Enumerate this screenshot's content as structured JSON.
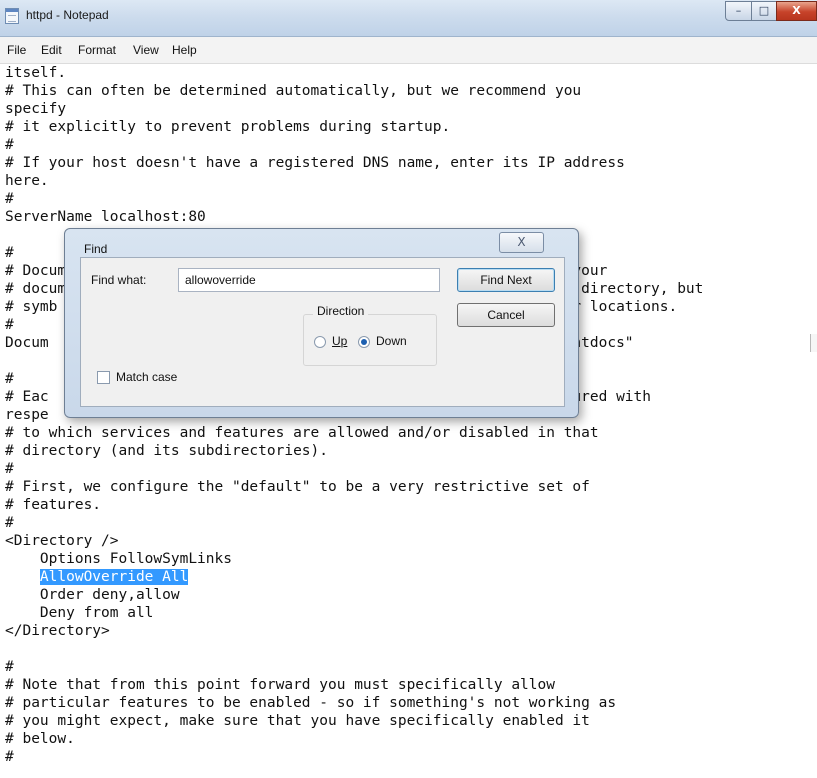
{
  "window": {
    "title": "httpd - Notepad",
    "minimize_glyph": "–",
    "maximize_glyph": "□",
    "close_glyph": "X"
  },
  "menu": [
    "File",
    "Edit",
    "Format",
    "View",
    "Help"
  ],
  "editor": {
    "lines": [
      "itself.",
      "# This can often be determined automatically, but we recommend you",
      "specify",
      "# it explicitly to prevent problems during startup.",
      "#",
      "# If your host doesn't have a registered DNS name, enter its IP address",
      "here.",
      "#",
      "ServerName localhost:80",
      "",
      "#",
      "# Documen                                                  serve your",
      "# docum                                                    n this directory, but",
      "# symb                                                     o other locations.",
      "#",
      "Docum                                                      ache2/htdocs\"",
      "",
      "#",
      "# Eac                                                      configured with",
      "respe",
      "# to which services and features are allowed and/or disabled in that",
      "# directory (and its subdirectories).",
      "#",
      "# First, we configure the \"default\" to be a very restrictive set of",
      "# features.",
      "#",
      "<Directory />",
      "    Options FollowSymLinks",
      "    AllowOverride All",
      "    Order deny,allow",
      "    Deny from all",
      "</Directory>",
      "",
      "#",
      "# Note that from this point forward you must specifically allow",
      "# particular features to be enabled - so if something's not working as",
      "# you might expect, make sure that you have specifically enabled it",
      "# below.",
      "#"
    ],
    "selected_line_index": 28,
    "selected_text": "AllowOverride All"
  },
  "find_dialog": {
    "title": "Find",
    "close_glyph": "X",
    "find_what_label": "Find what:",
    "find_what_value": "allowoverride",
    "find_next_label": "Find Next",
    "cancel_label": "Cancel",
    "direction_label": "Direction",
    "up_label": "Up",
    "down_label": "Down",
    "direction_selected": "Down",
    "match_case_label": "Match case",
    "match_case_checked": false
  }
}
